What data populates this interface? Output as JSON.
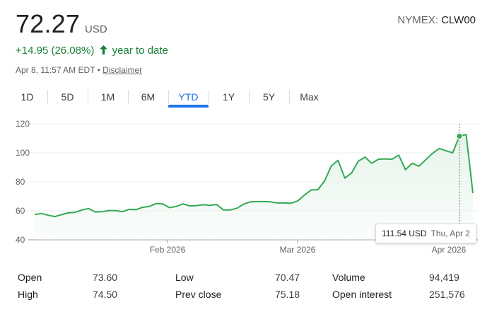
{
  "quote": {
    "price": "72.27",
    "currency": "USD",
    "exchange_label": "NYMEX:",
    "symbol": "CLW00",
    "change": "+14.95 (26.08%)",
    "change_arrow": "↑",
    "change_period": "year to date",
    "timestamp": "Apr 8, 11:57 AM EDT •",
    "disclaimer": "Disclaimer",
    "up_color": "#188038"
  },
  "tabs": [
    {
      "label": "1D"
    },
    {
      "label": "5D"
    },
    {
      "label": "1M"
    },
    {
      "label": "6M"
    },
    {
      "label": "YTD",
      "active": true
    },
    {
      "label": "1Y"
    },
    {
      "label": "5Y"
    },
    {
      "label": "Max"
    }
  ],
  "chart_data": {
    "type": "area",
    "title": "",
    "xlabel": "",
    "ylabel": "",
    "x_ticks": [
      "Feb 2026",
      "Mar 2026",
      "Apr 2026"
    ],
    "y_ticks": [
      40,
      60,
      80,
      100,
      120
    ],
    "ylim": [
      40,
      120
    ],
    "grid": true,
    "line_color": "#34a853",
    "fill_color": "#e6f4ea",
    "series": [
      {
        "values": [
          57.4,
          58.2,
          57.0,
          56.0,
          57.4,
          58.6,
          59.0,
          60.6,
          61.6,
          59.2,
          59.4,
          60.2,
          60.2,
          59.4,
          61.0,
          60.8,
          62.4,
          63.0,
          65.0,
          64.8,
          62.2,
          63.0,
          64.8,
          63.4,
          63.6,
          64.2,
          63.8,
          64.4,
          60.6,
          60.6,
          61.8,
          64.6,
          66.2,
          66.4,
          66.4,
          66.2,
          65.4,
          65.4,
          65.2,
          66.8,
          70.8,
          74.4,
          74.6,
          80.6,
          91.0,
          94.8,
          82.6,
          86.0,
          94.2,
          97.0,
          92.8,
          95.6,
          95.8,
          95.6,
          98.4,
          88.4,
          92.8,
          90.8,
          95.2,
          99.6,
          103.0,
          101.4,
          100.0,
          111.5,
          112.6,
          72.2
        ]
      }
    ],
    "hover": {
      "index": 63,
      "value": "111.54 USD",
      "date": "Thu, Apr 2"
    }
  },
  "stats": {
    "col1": [
      {
        "label": "Open",
        "value": "73.60"
      },
      {
        "label": "High",
        "value": "74.50"
      }
    ],
    "col2": [
      {
        "label": "Low",
        "value": "70.47"
      },
      {
        "label": "Prev close",
        "value": "75.18"
      }
    ],
    "col3": [
      {
        "label": "Volume",
        "value": "94,419"
      },
      {
        "label": "Open interest",
        "value": "251,576"
      }
    ]
  }
}
